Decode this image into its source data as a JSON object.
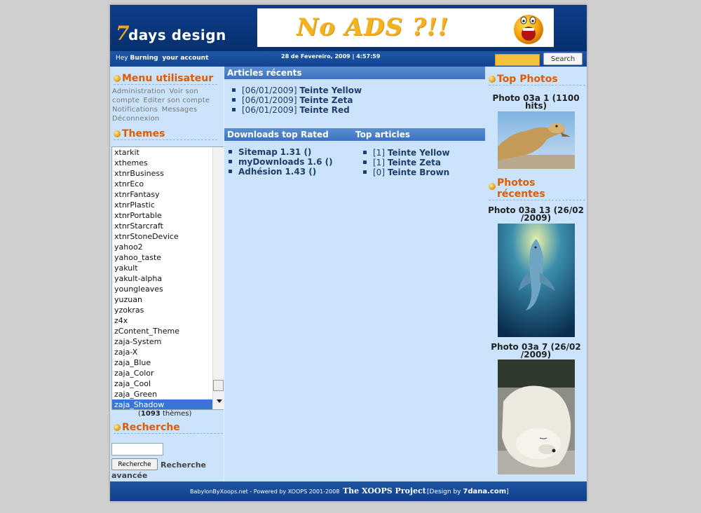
{
  "header": {
    "logo_seven": "7",
    "logo_text": "days design",
    "banner_text": "No ADS ?!!"
  },
  "userbar": {
    "greeting": "Hey",
    "username": "Burning",
    "account_link": "your account",
    "datetime": "28 de Fevereiro, 2009 | 4:57:59",
    "search_button": "Search"
  },
  "usermenu": {
    "title": "Menu utilisateur",
    "items": [
      "Administration",
      "Voir son compte",
      "Editer son compte",
      "Notifications",
      "Messages",
      "Déconnexion"
    ]
  },
  "themes": {
    "title": "Themes",
    "items": [
      "xtarkit",
      "xthemes",
      "xtnrBusiness",
      "xtnrEco",
      "xtnrFantasy",
      "xtnrPlastic",
      "xtnrPortable",
      "xtnrStarcraft",
      "xtnrStoneDevice",
      "yahoo2",
      "yahoo_taste",
      "yakult",
      "yakult-alpha",
      "youngleaves",
      "yuzuan",
      "yzokras",
      "z4x",
      "zContent_Theme",
      "zaja-System",
      "zaja-X",
      "zaja_Blue",
      "zaja_Color",
      "zaja_Cool",
      "zaja_Green",
      "zaja_Shadow"
    ],
    "selected": "zaja_Shadow",
    "count_open": "(",
    "count": "1093",
    "count_label": "thèmes)"
  },
  "recherche": {
    "title": "Recherche",
    "button": "Recherche",
    "advanced_line1": "Recherche",
    "advanced_line2": "avancée"
  },
  "articles": {
    "title": "Articles récents",
    "items": [
      {
        "date": "[06/01/2009]",
        "title": "Teinte Yellow"
      },
      {
        "date": "[06/01/2009]",
        "title": "Teinte Zeta"
      },
      {
        "date": "[06/01/2009]",
        "title": "Teinte Red"
      }
    ]
  },
  "downloads": {
    "title": "Downloads top Rated",
    "items": [
      {
        "title": "Sitemap",
        "value": "1.31 ()"
      },
      {
        "title": "myDownloads",
        "value": "1.6 ()"
      },
      {
        "title": "Adhésion",
        "value": "1.43 ()"
      }
    ]
  },
  "top_articles": {
    "title": "Top articles",
    "items": [
      {
        "count": "[1]",
        "title": "Teinte Yellow"
      },
      {
        "count": "[1]",
        "title": "Teinte Zeta"
      },
      {
        "count": "[0]",
        "title": "Teinte Brown"
      }
    ]
  },
  "top_photos": {
    "title": "Top Photos",
    "caption": "Photo 03a 1 (1100 hits)"
  },
  "recent_photos": {
    "title_line1": "Photos",
    "title_line2": "récentes",
    "items": [
      {
        "caption": "Photo 03a 13 (26/02 /2009)"
      },
      {
        "caption": "Photo 03a 7 (26/02 /2009)"
      }
    ]
  },
  "footer": {
    "powered": "BabylonByXoops.net - Powered by XOOPS 2001-2008",
    "project": "The XOOPS Project",
    "design_prefix": "[Design by",
    "design_by": "7dana.com",
    "design_suffix": "]"
  }
}
